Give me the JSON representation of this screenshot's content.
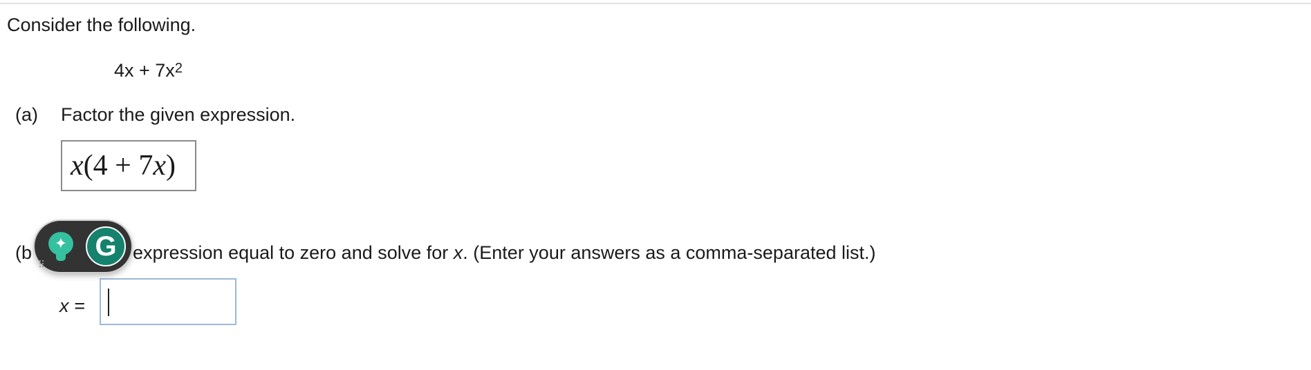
{
  "question": {
    "intro": "Consider the following.",
    "expression": {
      "base": "4x + 7x",
      "exponent": "2"
    }
  },
  "part_a": {
    "label": "(a)",
    "text": "Factor the given expression.",
    "answer": {
      "pre": "x",
      "paren_open": "(",
      "body_num": "4 + 7",
      "var": "x",
      "paren_close": ")"
    }
  },
  "part_b": {
    "label": "(b",
    "text_visible": "expression equal to zero and solve for ",
    "text_var": "x",
    "text_rest": ". (Enter your answers as a comma-separated list.)",
    "answer_prefix": "x =",
    "answer_value": ""
  },
  "grammarly_widget": {
    "assist_icon": "lightbulb-sparkle-icon",
    "logo_icon": "grammarly-g-icon",
    "logo_letter": "G",
    "accent_color": "#15826d"
  }
}
